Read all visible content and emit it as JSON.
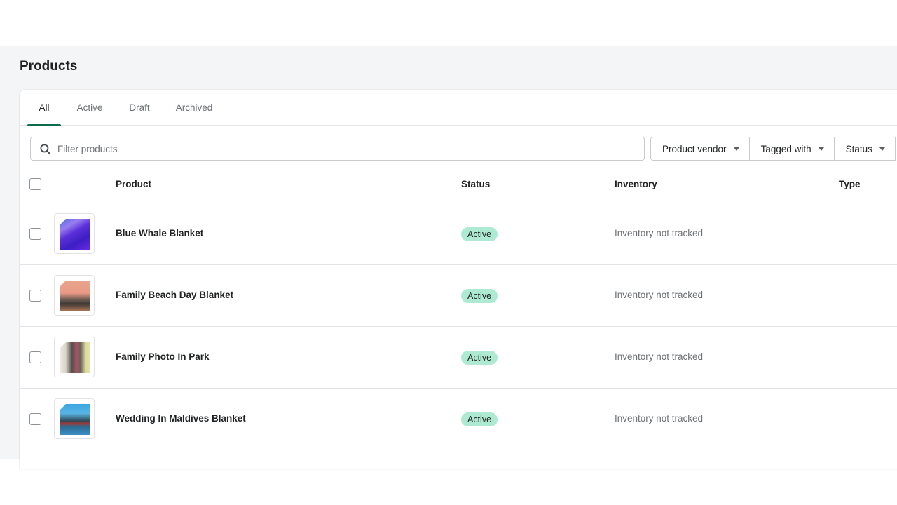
{
  "page": {
    "title": "Products"
  },
  "tabs": [
    {
      "label": "All",
      "active": true
    },
    {
      "label": "Active",
      "active": false
    },
    {
      "label": "Draft",
      "active": false
    },
    {
      "label": "Archived",
      "active": false
    }
  ],
  "search": {
    "placeholder": "Filter products",
    "value": "",
    "icon": "search-icon"
  },
  "filters": [
    {
      "label": "Product vendor",
      "icon": "caret-down-icon"
    },
    {
      "label": "Tagged with",
      "icon": "caret-down-icon"
    },
    {
      "label": "Status",
      "icon": "caret-down-icon"
    }
  ],
  "table": {
    "columns": [
      "Product",
      "Status",
      "Inventory",
      "Type"
    ],
    "rows": [
      {
        "name": "Blue Whale Blanket",
        "status": "Active",
        "inventory": "Inventory not tracked",
        "type": "",
        "thumbnail": "blue-whale-blanket-image"
      },
      {
        "name": "Family Beach Day Blanket",
        "status": "Active",
        "inventory": "Inventory not tracked",
        "type": "",
        "thumbnail": "family-beach-day-blanket-image"
      },
      {
        "name": "Family Photo In Park",
        "status": "Active",
        "inventory": "Inventory not tracked",
        "type": "",
        "thumbnail": "family-photo-in-park-image"
      },
      {
        "name": "Wedding In Maldives Blanket",
        "status": "Active",
        "inventory": "Inventory not tracked",
        "type": "",
        "thumbnail": "wedding-in-maldives-blanket-image"
      }
    ]
  },
  "colors": {
    "accent": "#0b6b4c",
    "badge_active_bg": "#aee9d1",
    "page_bg": "#f4f5f7"
  }
}
